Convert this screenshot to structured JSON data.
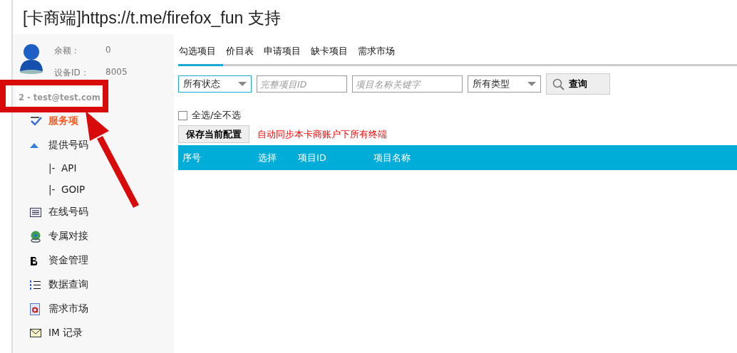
{
  "title": {
    "bracket_open": "[",
    "brand": "卡商端",
    "bracket_close": "]",
    "url": "https://t.me/firefox_fun",
    "support": "支持"
  },
  "profile": {
    "balance_label": "余额：",
    "balance": "0",
    "device_label": "设备ID：",
    "device": "8005",
    "account": "2 - test@test.com"
  },
  "sidebar": {
    "items": [
      {
        "label": "服务项",
        "selected": true
      },
      {
        "label": "提供号码",
        "selected": false,
        "children": [
          {
            "label": "|-  API",
            "selected": false
          },
          {
            "label": "|-  GOIP",
            "selected": false
          }
        ]
      },
      {
        "label": "在线号码",
        "selected": false
      },
      {
        "label": "专属对接",
        "selected": false
      },
      {
        "label": "资金管理",
        "selected": false
      },
      {
        "label": "数据查询",
        "selected": false
      },
      {
        "label": "需求市场",
        "selected": false
      },
      {
        "label": "IM 记录",
        "selected": false
      }
    ]
  },
  "tabs": [
    {
      "label": "勾选项目",
      "selected": true
    },
    {
      "label": "价目表",
      "selected": false
    },
    {
      "label": "申请项目",
      "selected": false
    },
    {
      "label": "缺卡项目",
      "selected": false
    },
    {
      "label": "需求市场",
      "selected": false
    }
  ],
  "filters": {
    "status": "所有状态",
    "project_id_placeholder": "完整项目ID",
    "keyword_placeholder": "项目名称关键字",
    "type": "所有类型",
    "query_button": "查询"
  },
  "select_all": {
    "label": "全选/全不选",
    "checked": false
  },
  "save_button": "保存当前配置",
  "sync_note": "自动同步本卡商账户下所有终端",
  "table": {
    "columns": [
      "序号",
      "选择",
      "项目ID",
      "项目名称"
    ]
  },
  "annotation": {
    "kind": "highlight-arrow"
  }
}
